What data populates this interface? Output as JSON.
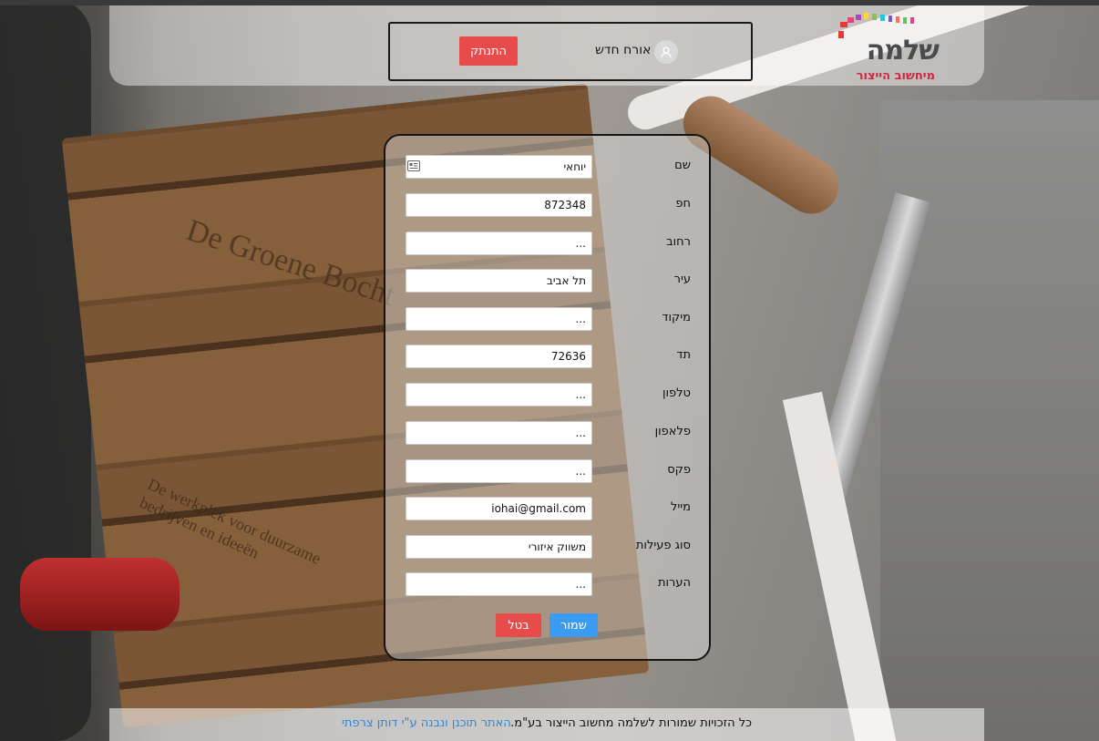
{
  "header": {
    "logo_title": "שלמה",
    "logo_subtitle": "מיחשוב הייצור",
    "user_name": "אורח חדש",
    "logout_label": "התנתק"
  },
  "form": {
    "fields": [
      {
        "label": "שם",
        "value": "יוחאי"
      },
      {
        "label": "חפ",
        "value": "872348"
      },
      {
        "label": "רחוב",
        "value": "..."
      },
      {
        "label": "עיר",
        "value": "תל אביב"
      },
      {
        "label": "מיקוד",
        "value": "..."
      },
      {
        "label": "תד",
        "value": "72636"
      },
      {
        "label": "טלפון",
        "value": "..."
      },
      {
        "label": "פלאפון",
        "value": "..."
      },
      {
        "label": "פקס",
        "value": "..."
      },
      {
        "label": "מייל",
        "value": "iohai@gmail.com"
      },
      {
        "label": "סוג פעילות",
        "value": "משווק איזורי"
      },
      {
        "label": "הערות",
        "value": "..."
      }
    ],
    "save_label": "שמור",
    "cancel_label": "בטל"
  },
  "footer": {
    "copyright": "כל הזכויות שמורות לשלמה מחשוב הייצור בע\"מ.",
    "credit_link": "האתר תוכנן ונבנה ע\"י דותן צרפתי"
  },
  "colors": {
    "danger": "#e84b4b",
    "primary": "#3b9bf0",
    "link": "#2e86d8",
    "logo_red": "#d0263f"
  }
}
